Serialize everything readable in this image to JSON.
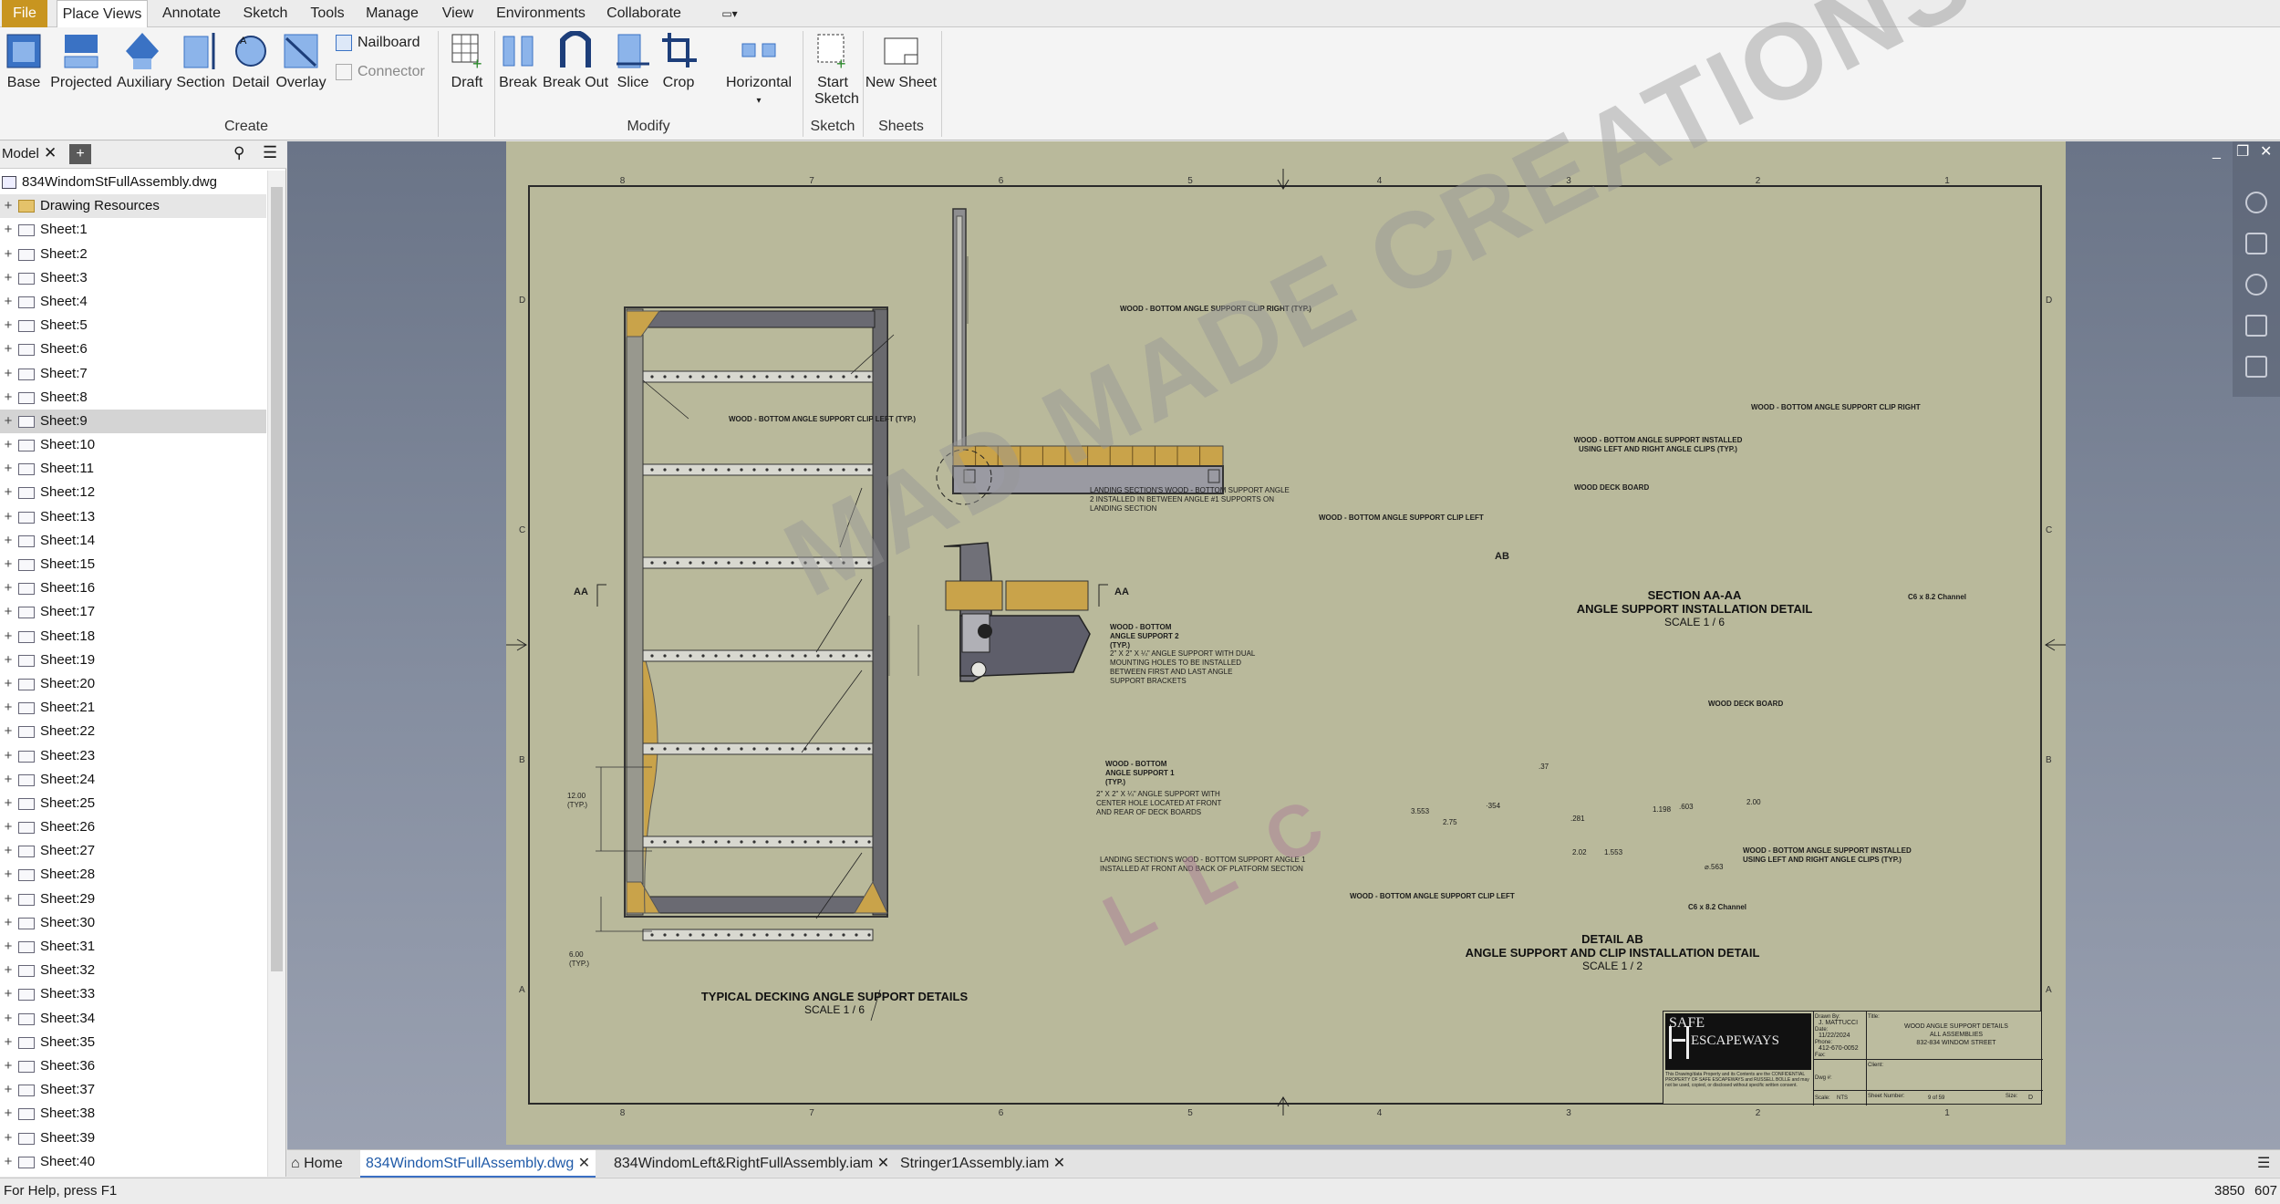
{
  "menu": {
    "file": "File",
    "items": [
      "Place Views",
      "Annotate",
      "Sketch",
      "Tools",
      "Manage",
      "View",
      "Environments",
      "Collaborate"
    ]
  },
  "ribbon": {
    "buttons": [
      "Base",
      "Projected",
      "Auxiliary",
      "Section",
      "Detail",
      "Overlay",
      "Draft",
      "Break",
      "Break Out",
      "Slice",
      "Crop",
      "Horizontal",
      "Start Sketch",
      "New Sheet"
    ],
    "small": [
      "Nailboard",
      "Connector"
    ],
    "groups": [
      "Create",
      "Modify",
      "Sketch",
      "Sheets"
    ]
  },
  "browser": {
    "tab": "Model",
    "file": "834WindomStFullAssembly.dwg",
    "resources": "Drawing Resources",
    "sheets": [
      "Sheet:1",
      "Sheet:2",
      "Sheet:3",
      "Sheet:4",
      "Sheet:5",
      "Sheet:6",
      "Sheet:7",
      "Sheet:8",
      "Sheet:9",
      "Sheet:10",
      "Sheet:11",
      "Sheet:12",
      "Sheet:13",
      "Sheet:14",
      "Sheet:15",
      "Sheet:16",
      "Sheet:17",
      "Sheet:18",
      "Sheet:19",
      "Sheet:20",
      "Sheet:21",
      "Sheet:22",
      "Sheet:23",
      "Sheet:24",
      "Sheet:25",
      "Sheet:26",
      "Sheet:27",
      "Sheet:28",
      "Sheet:29",
      "Sheet:30",
      "Sheet:31",
      "Sheet:32",
      "Sheet:33",
      "Sheet:34",
      "Sheet:35",
      "Sheet:36",
      "Sheet:37",
      "Sheet:38",
      "Sheet:39",
      "Sheet:40"
    ],
    "selected_sheet": "Sheet:9"
  },
  "drawing": {
    "main_title": "TYPICAL DECKING ANGLE SUPPORT DETAILS",
    "main_scale": "SCALE 1 / 6",
    "section_title1": "SECTION AA-AA",
    "section_title2": "ANGLE SUPPORT INSTALLATION DETAIL",
    "section_scale": "SCALE 1 / 6",
    "detail_title1": "DETAIL  AB",
    "detail_title2": "ANGLE SUPPORT AND CLIP INSTALLATION DETAIL",
    "detail_scale": "SCALE 1 / 2",
    "notes": {
      "clip_right": "WOOD - BOTTOM ANGLE SUPPORT CLIP RIGHT (TYP.)",
      "clip_left": "WOOD - BOTTOM ANGLE SUPPORT CLIP LEFT (TYP.)",
      "landing2": "LANDING SECTION'S WOOD - BOTTOM SUPPORT ANGLE 2 INSTALLED IN BETWEEN ANGLE #1 SUPPORTS ON LANDING SECTION",
      "support2": "WOOD - BOTTOM ANGLE SUPPORT 2 (TYP.)",
      "support2_desc": "2\" X 2\" X ¼\" ANGLE SUPPORT WITH DUAL MOUNTING HOLES TO BE INSTALLED BETWEEN FIRST AND LAST ANGLE SUPPORT BRACKETS",
      "support1": "WOOD - BOTTOM ANGLE SUPPORT 1 (TYP.)",
      "support1_desc": "2\" X 2\" X ¼\" ANGLE SUPPORT WITH CENTER HOLE LOCATED AT FRONT AND REAR OF DECK BOARDS",
      "landing1": "LANDING SECTION'S WOOD - BOTTOM SUPPORT ANGLE 1 INSTALLED AT FRONT AND BACK OF PLATFORM SECTION",
      "sec_clip_right": "WOOD - BOTTOM ANGLE SUPPORT CLIP RIGHT",
      "sec_support": "WOOD - BOTTOM ANGLE SUPPORT INSTALLED USING LEFT AND RIGHT ANGLE CLIPS (TYP.)",
      "sec_deck": "WOOD DECK BOARD",
      "sec_clip_left": "WOOD - BOTTOM ANGLE SUPPORT CLIP LEFT",
      "sec_channel": "C6 x 8.2 Channel",
      "det_deck": "WOOD DECK BOARD",
      "det_support": "WOOD - BOTTOM ANGLE SUPPORT INSTALLED USING LEFT AND RIGHT ANGLE CLIPS (TYP.)",
      "det_clip_left": "WOOD - BOTTOM ANGLE SUPPORT CLIP LEFT",
      "det_channel": "C6 x 8.2 Channel"
    },
    "dims": {
      "d12": "12.00",
      "typ": "(TYP.)",
      "d6": "6.00",
      "d3553": "3.553",
      "d275": "2.75",
      "d354": "·354",
      "d281": ".281",
      "d1198": "1.198",
      "d603": ".603",
      "d200": "2.00",
      "d202": "2.02",
      "d1553": "1.553",
      "d563": "⌀.563",
      "d37": ".37"
    },
    "labels": {
      "aa": "AA",
      "ab": "AB"
    },
    "border_cols": [
      "8",
      "7",
      "6",
      "5",
      "4",
      "3",
      "2",
      "1"
    ],
    "border_rows": [
      "D",
      "C",
      "B",
      "A"
    ],
    "watermark": "MAD MADE CREATIONS",
    "watermark2": "LLC",
    "titleblock": {
      "logo1": "SAFE",
      "logo2": "ESCAPEWAYS",
      "drawn_by_label": "Drawn By:",
      "drawn_by": "J. MATTUCCI",
      "date_label": "Date:",
      "date": "11/22/2024",
      "phone_label": "Phone:",
      "phone": "412-670-0052",
      "fax_label": "Fax:",
      "title_label": "Title:",
      "title1": "WOOD ANGLE SUPPORT DETAILS",
      "title2": "ALL ASSEMBLIES",
      "title3": "832-834 WINDOM STREET",
      "client_label": "Client:",
      "dwg_label": "Dwg #:",
      "scale_label": "Scale:",
      "scale": "NTS",
      "sheet_label": "Sheet Number:",
      "sheet": "9 of 59",
      "size_label": "Size:",
      "size": "D",
      "disclaimer": "This Drawing/data Property and its Contents are the CONFIDENTIAL PROPERTY OF SAFE ESCAPEWAYS and RUSSELL BOLLE and may not be used, copied, or disclosed without specific written consent."
    }
  },
  "doctabs": {
    "home": "Home",
    "tabs": [
      "834WindomStFullAssembly.dwg",
      "834WindomLeft&RightFullAssembly.iam",
      "Stringer1Assembly.iam"
    ]
  },
  "status": {
    "help": "For Help, press F1",
    "x": "3850",
    "y": "607"
  }
}
